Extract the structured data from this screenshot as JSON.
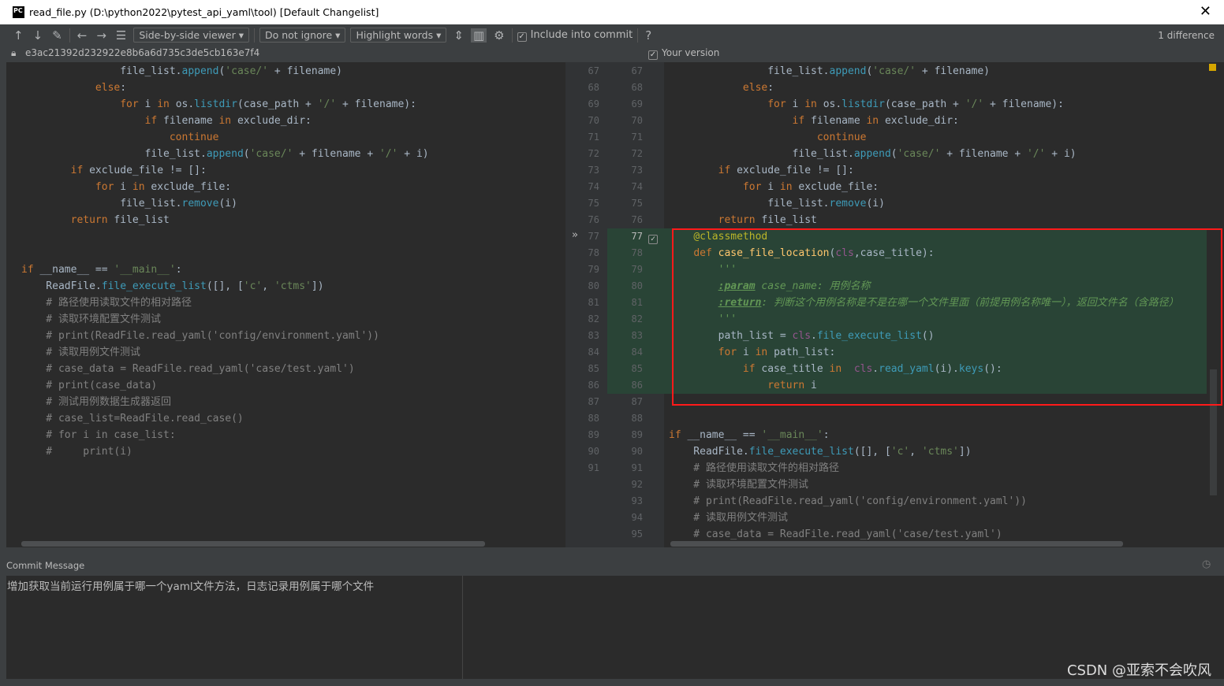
{
  "window": {
    "title": "read_file.py (D:\\python2022\\pytest_api_yaml\\tool) [Default Changelist]",
    "logo": "PC"
  },
  "toolbar": {
    "viewer": "Side-by-side viewer",
    "ignore": "Do not ignore",
    "highlight": "Highlight words",
    "include_commit": "Include into commit",
    "help": "?",
    "difference_count": "1 difference",
    "icons": [
      "arrow-up-icon",
      "arrow-down-icon",
      "edit-icon",
      "arrow-left-icon",
      "arrow-right-icon",
      "list-icon",
      "collapse-icon",
      "sync-scroll-icon",
      "gear-icon"
    ]
  },
  "left_header": {
    "revision": "e3ac21392d232922e8b6a6d735c3de5cb163e7f4"
  },
  "right_header": {
    "label": "Your version"
  },
  "left_lines": [
    "67",
    "68",
    "69",
    "70",
    "71",
    "72",
    "73",
    "74",
    "75",
    "76",
    "77",
    "78",
    "79",
    "80",
    "81",
    "82",
    "83",
    "84",
    "85",
    "86",
    "87",
    "88",
    "89",
    "90",
    "91"
  ],
  "right_lines": [
    "67",
    "68",
    "69",
    "70",
    "71",
    "72",
    "73",
    "74",
    "75",
    "76",
    "77",
    "78",
    "79",
    "80",
    "81",
    "82",
    "83",
    "84",
    "85",
    "86",
    "87",
    "88",
    "89",
    "90",
    "91",
    "92",
    "93",
    "94",
    "95"
  ],
  "left_code": [
    [
      [
        "                file_list.",
        "tx"
      ],
      [
        "append",
        "fn"
      ],
      [
        "(",
        "tx"
      ],
      [
        "'case/'",
        "st"
      ],
      [
        " + filename)",
        "tx"
      ]
    ],
    [
      [
        "            ",
        "tx"
      ],
      [
        "else",
        "kw"
      ],
      [
        ":",
        "tx"
      ]
    ],
    [
      [
        "                ",
        "tx"
      ],
      [
        "for ",
        "kw"
      ],
      [
        "i ",
        "tx"
      ],
      [
        "in ",
        "kw"
      ],
      [
        "os.",
        "tx"
      ],
      [
        "listdir",
        "fn"
      ],
      [
        "(case_path + ",
        "tx"
      ],
      [
        "'/'",
        "st"
      ],
      [
        " + filename):",
        "tx"
      ]
    ],
    [
      [
        "                    ",
        "tx"
      ],
      [
        "if ",
        "kw"
      ],
      [
        "filename ",
        "tx"
      ],
      [
        "in ",
        "kw"
      ],
      [
        "exclude_dir:",
        "tx"
      ]
    ],
    [
      [
        "                        ",
        "tx"
      ],
      [
        "continue",
        "kw"
      ]
    ],
    [
      [
        "                    file_list.",
        "tx"
      ],
      [
        "append",
        "fn"
      ],
      [
        "(",
        "tx"
      ],
      [
        "'case/'",
        "st"
      ],
      [
        " + filename + ",
        "tx"
      ],
      [
        "'/'",
        "st"
      ],
      [
        " + i)",
        "tx"
      ]
    ],
    [
      [
        "        ",
        "tx"
      ],
      [
        "if ",
        "kw"
      ],
      [
        "exclude_file != []:",
        "tx"
      ]
    ],
    [
      [
        "            ",
        "tx"
      ],
      [
        "for ",
        "kw"
      ],
      [
        "i ",
        "tx"
      ],
      [
        "in ",
        "kw"
      ],
      [
        "exclude_file:",
        "tx"
      ]
    ],
    [
      [
        "                file_list.",
        "tx"
      ],
      [
        "remove",
        "fn"
      ],
      [
        "(i)",
        "tx"
      ]
    ],
    [
      [
        "        ",
        "tx"
      ],
      [
        "return ",
        "kw"
      ],
      [
        "file_list",
        "tx"
      ]
    ],
    [],
    [],
    [
      [
        "if ",
        "kw"
      ],
      [
        "__name__ == ",
        "tx"
      ],
      [
        "'__main__'",
        "st"
      ],
      [
        ":",
        "tx"
      ]
    ],
    [
      [
        "    ReadFile.",
        "tx"
      ],
      [
        "file_execute_list",
        "fn"
      ],
      [
        "([], [",
        "tx"
      ],
      [
        "'c'",
        "st"
      ],
      [
        ", ",
        "tx"
      ],
      [
        "'ctms'",
        "st"
      ],
      [
        "])",
        "tx"
      ]
    ],
    [
      [
        "    # 路径使用读取文件的相对路径",
        "cm"
      ]
    ],
    [
      [
        "    # 读取环境配置文件测试",
        "cm"
      ]
    ],
    [
      [
        "    # print(ReadFile.read_yaml('config/environment.yaml'))",
        "cm"
      ]
    ],
    [
      [
        "    # 读取用例文件测试",
        "cm"
      ]
    ],
    [
      [
        "    # case_data = ReadFile.read_yaml('case/test.yaml')",
        "cm"
      ]
    ],
    [
      [
        "    # print(case_data)",
        "cm"
      ]
    ],
    [
      [
        "    # 测试用例数据生成器返回",
        "cm"
      ]
    ],
    [
      [
        "    # case_list=ReadFile.read_case()",
        "cm"
      ]
    ],
    [
      [
        "    # for i in case_list:",
        "cm"
      ]
    ],
    [
      [
        "    #     print(i)",
        "cm"
      ]
    ]
  ],
  "right_code": [
    [
      [
        "                file_list.",
        "tx"
      ],
      [
        "append",
        "fn"
      ],
      [
        "(",
        "tx"
      ],
      [
        "'case/'",
        "st"
      ],
      [
        " + filename)",
        "tx"
      ]
    ],
    [
      [
        "            ",
        "tx"
      ],
      [
        "else",
        "kw"
      ],
      [
        ":",
        "tx"
      ]
    ],
    [
      [
        "                ",
        "tx"
      ],
      [
        "for ",
        "kw"
      ],
      [
        "i ",
        "tx"
      ],
      [
        "in ",
        "kw"
      ],
      [
        "os.",
        "tx"
      ],
      [
        "listdir",
        "fn"
      ],
      [
        "(case_path + ",
        "tx"
      ],
      [
        "'/'",
        "st"
      ],
      [
        " + filename):",
        "tx"
      ]
    ],
    [
      [
        "                    ",
        "tx"
      ],
      [
        "if ",
        "kw"
      ],
      [
        "filename ",
        "tx"
      ],
      [
        "in ",
        "kw"
      ],
      [
        "exclude_dir:",
        "tx"
      ]
    ],
    [
      [
        "                        ",
        "tx"
      ],
      [
        "continue",
        "kw"
      ]
    ],
    [
      [
        "                    file_list.",
        "tx"
      ],
      [
        "append",
        "fn"
      ],
      [
        "(",
        "tx"
      ],
      [
        "'case/'",
        "st"
      ],
      [
        " + filename + ",
        "tx"
      ],
      [
        "'/'",
        "st"
      ],
      [
        " + i)",
        "tx"
      ]
    ],
    [
      [
        "        ",
        "tx"
      ],
      [
        "if ",
        "kw"
      ],
      [
        "exclude_file != []:",
        "tx"
      ]
    ],
    [
      [
        "            ",
        "tx"
      ],
      [
        "for ",
        "kw"
      ],
      [
        "i ",
        "tx"
      ],
      [
        "in ",
        "kw"
      ],
      [
        "exclude_file:",
        "tx"
      ]
    ],
    [
      [
        "                file_list.",
        "tx"
      ],
      [
        "remove",
        "fn"
      ],
      [
        "(i)",
        "tx"
      ]
    ],
    [
      [
        "        ",
        "tx"
      ],
      [
        "return ",
        "kw"
      ],
      [
        "file_list",
        "tx"
      ]
    ],
    [
      [
        "    ",
        "tx"
      ],
      [
        "@classmethod",
        "de"
      ]
    ],
    [
      [
        "    ",
        "tx"
      ],
      [
        "def ",
        "kw"
      ],
      [
        "case_file_location",
        "df"
      ],
      [
        "(",
        "tx"
      ],
      [
        "cls",
        "cl"
      ],
      [
        ",case_title):",
        "tx"
      ]
    ],
    [
      [
        "        '''",
        "dc"
      ]
    ],
    [
      [
        "        ",
        "tx"
      ],
      [
        ":param",
        "dt"
      ],
      [
        " case_name: 用例名称",
        "dc"
      ]
    ],
    [
      [
        "        ",
        "tx"
      ],
      [
        ":return",
        "dt"
      ],
      [
        ": 判断这个用例名称是不是在哪一个文件里面（前提用例名称唯一），返回文件名（含路径）",
        "dc"
      ]
    ],
    [
      [
        "        '''",
        "dc"
      ]
    ],
    [
      [
        "        path_list = ",
        "tx"
      ],
      [
        "cls",
        "cl"
      ],
      [
        ".",
        "tx"
      ],
      [
        "file_execute_list",
        "fn"
      ],
      [
        "()",
        "tx"
      ]
    ],
    [
      [
        "        ",
        "tx"
      ],
      [
        "for ",
        "kw"
      ],
      [
        "i ",
        "tx"
      ],
      [
        "in ",
        "kw"
      ],
      [
        "path_list:",
        "tx"
      ]
    ],
    [
      [
        "            ",
        "tx"
      ],
      [
        "if ",
        "kw"
      ],
      [
        "case_title ",
        "tx"
      ],
      [
        "in  ",
        "kw"
      ],
      [
        "cls",
        "cl"
      ],
      [
        ".",
        "tx"
      ],
      [
        "read_yaml",
        "fn"
      ],
      [
        "(i).",
        "tx"
      ],
      [
        "keys",
        "fn"
      ],
      [
        "():",
        "tx"
      ]
    ],
    [
      [
        "                ",
        "tx"
      ],
      [
        "return ",
        "kw"
      ],
      [
        "i",
        "tx"
      ]
    ],
    [],
    [],
    [
      [
        "if ",
        "kw"
      ],
      [
        "__name__ == ",
        "tx"
      ],
      [
        "'__main__'",
        "st"
      ],
      [
        ":",
        "tx"
      ]
    ],
    [
      [
        "    ReadFile.",
        "tx"
      ],
      [
        "file_execute_list",
        "fn"
      ],
      [
        "([], [",
        "tx"
      ],
      [
        "'c'",
        "st"
      ],
      [
        ", ",
        "tx"
      ],
      [
        "'ctms'",
        "st"
      ],
      [
        "])",
        "tx"
      ]
    ],
    [
      [
        "    # 路径使用读取文件的相对路径",
        "cm"
      ]
    ],
    [
      [
        "    # 读取环境配置文件测试",
        "cm"
      ]
    ],
    [
      [
        "    # print(ReadFile.read_yaml('config/environment.yaml'))",
        "cm"
      ]
    ],
    [
      [
        "    # 读取用例文件测试",
        "cm"
      ]
    ],
    [
      [
        "    # case_data = ReadFile.read_yaml('case/test.yaml')",
        "cm"
      ]
    ]
  ],
  "colors": {
    "inserted_bg": "#294436",
    "highlight_box": "#ff1a1a",
    "editor_bg": "#2b2b2b"
  },
  "commit": {
    "label": "Commit Message",
    "message": "增加获取当前运行用例属于哪一个yaml文件方法，日志记录用例属于哪个文件"
  },
  "watermark": "CSDN @亚索不会吹风"
}
